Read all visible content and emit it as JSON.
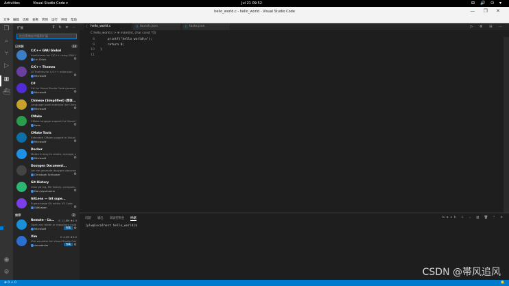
{
  "gnome": {
    "activities": "Activities",
    "app": "Visual Studio Code ▾",
    "clock": "Jul 21  09:52",
    "tray": "⊞ 🔊 ⏻ ▾"
  },
  "window": {
    "title": "hello_world.c - hello_world - Visual Studio Code",
    "controls": "— ❐ ✕"
  },
  "menu": [
    "文件",
    "编辑",
    "选择",
    "查看",
    "转到",
    "运行",
    "终端",
    "帮助"
  ],
  "sidebar": {
    "header": "扩展",
    "tools": "⊽ ↻ ≡ ⋯",
    "search_placeholder": "在应用商店中搜索扩展",
    "installed_label": "已安装",
    "installed_count": "14",
    "recommended_label": "推荐",
    "recommended_count": "2",
    "installed": [
      {
        "name": "C/C++ GNU Global",
        "meta": "",
        "desc": "Intellisense for C/C++ using GNU Global",
        "pub": "Lin Chich",
        "color": "#3a7fc6"
      },
      {
        "name": "C/C++ Themes",
        "meta": "",
        "desc": "UI Themes for C/C++ extension",
        "pub": "Microsoft",
        "color": "#6b3fa0"
      },
      {
        "name": "C#",
        "meta": "",
        "desc": "C# for Visual Studio Code (powered by...)",
        "pub": "Microsoft",
        "color": "#512bd4"
      },
      {
        "name": "Chinese (Simplified) (简体...",
        "meta": "",
        "desc": "Language pack extension for Chinese",
        "pub": "Microsoft",
        "color": "#c8a12c"
      },
      {
        "name": "CMake",
        "meta": "",
        "desc": "CMake langage support for Visual Studio",
        "pub": "twxs",
        "color": "#2a9d4b"
      },
      {
        "name": "CMake Tools",
        "meta": "",
        "desc": "Extended CMake support in Visual Studio",
        "pub": "Microsoft",
        "color": "#0e6ea8"
      },
      {
        "name": "Docker",
        "meta": "",
        "desc": "Makes it easy to create, manage, and...",
        "pub": "Microsoft",
        "color": "#1d91e6"
      },
      {
        "name": "Doxygen Document...",
        "meta": "",
        "desc": "Let me generate doxygen documentation",
        "pub": "Christoph Schlosser",
        "color": "#444"
      },
      {
        "name": "Git History",
        "meta": "",
        "desc": "View git log, file history, compare...",
        "pub": "Don Jayamanne",
        "color": "#2bb673"
      },
      {
        "name": "GitLens — Git supe...",
        "meta": "",
        "desc": "Supercharge Git within VS Code",
        "pub": "GitKraken",
        "color": "#7b3ee8"
      }
    ],
    "recommended": [
      {
        "name": "Remote - Co...",
        "meta": "⊙ 11.8M ★4.5",
        "desc": "Open any folder or repository inside a D...",
        "pub": "Microsoft",
        "btn": "安装",
        "color": "#1a8fd8"
      },
      {
        "name": "Vim",
        "meta": "⊙ 4.2M ★3.5",
        "desc": "Vim emulator for Visual Studio Code",
        "pub": "vscodevim",
        "btn": "安装",
        "color": "#2b6fd1"
      }
    ]
  },
  "editor": {
    "tabs": [
      {
        "label": "hello_world.c",
        "icon": "C"
      },
      {
        "label": "launch.json",
        "icon": "{}"
      },
      {
        "label": "tasks.json",
        "icon": "{}"
      }
    ],
    "tools": "▷ ⚙ ⊟ ⋯",
    "breadcrumb": "C hello_world.c > ⊕ main(int, char const *[])",
    "lines": [
      "8",
      "9",
      "10",
      "11"
    ],
    "code": "    printf(\"hello world\\n\");\n    return 0;\n}\n"
  },
  "panel": {
    "tabs": [
      "问题",
      "输出",
      "调试控制台",
      "终端"
    ],
    "tools": "bash ＋ ⌵ ▥ 🗑 ⌃ ✕",
    "prompt": "[ylw@localhost hello_world]$ "
  },
  "status": {
    "left": "⊗ 0 ⚠ 0",
    "right": "🔔"
  },
  "watermark": "CSDN @帯风追风"
}
